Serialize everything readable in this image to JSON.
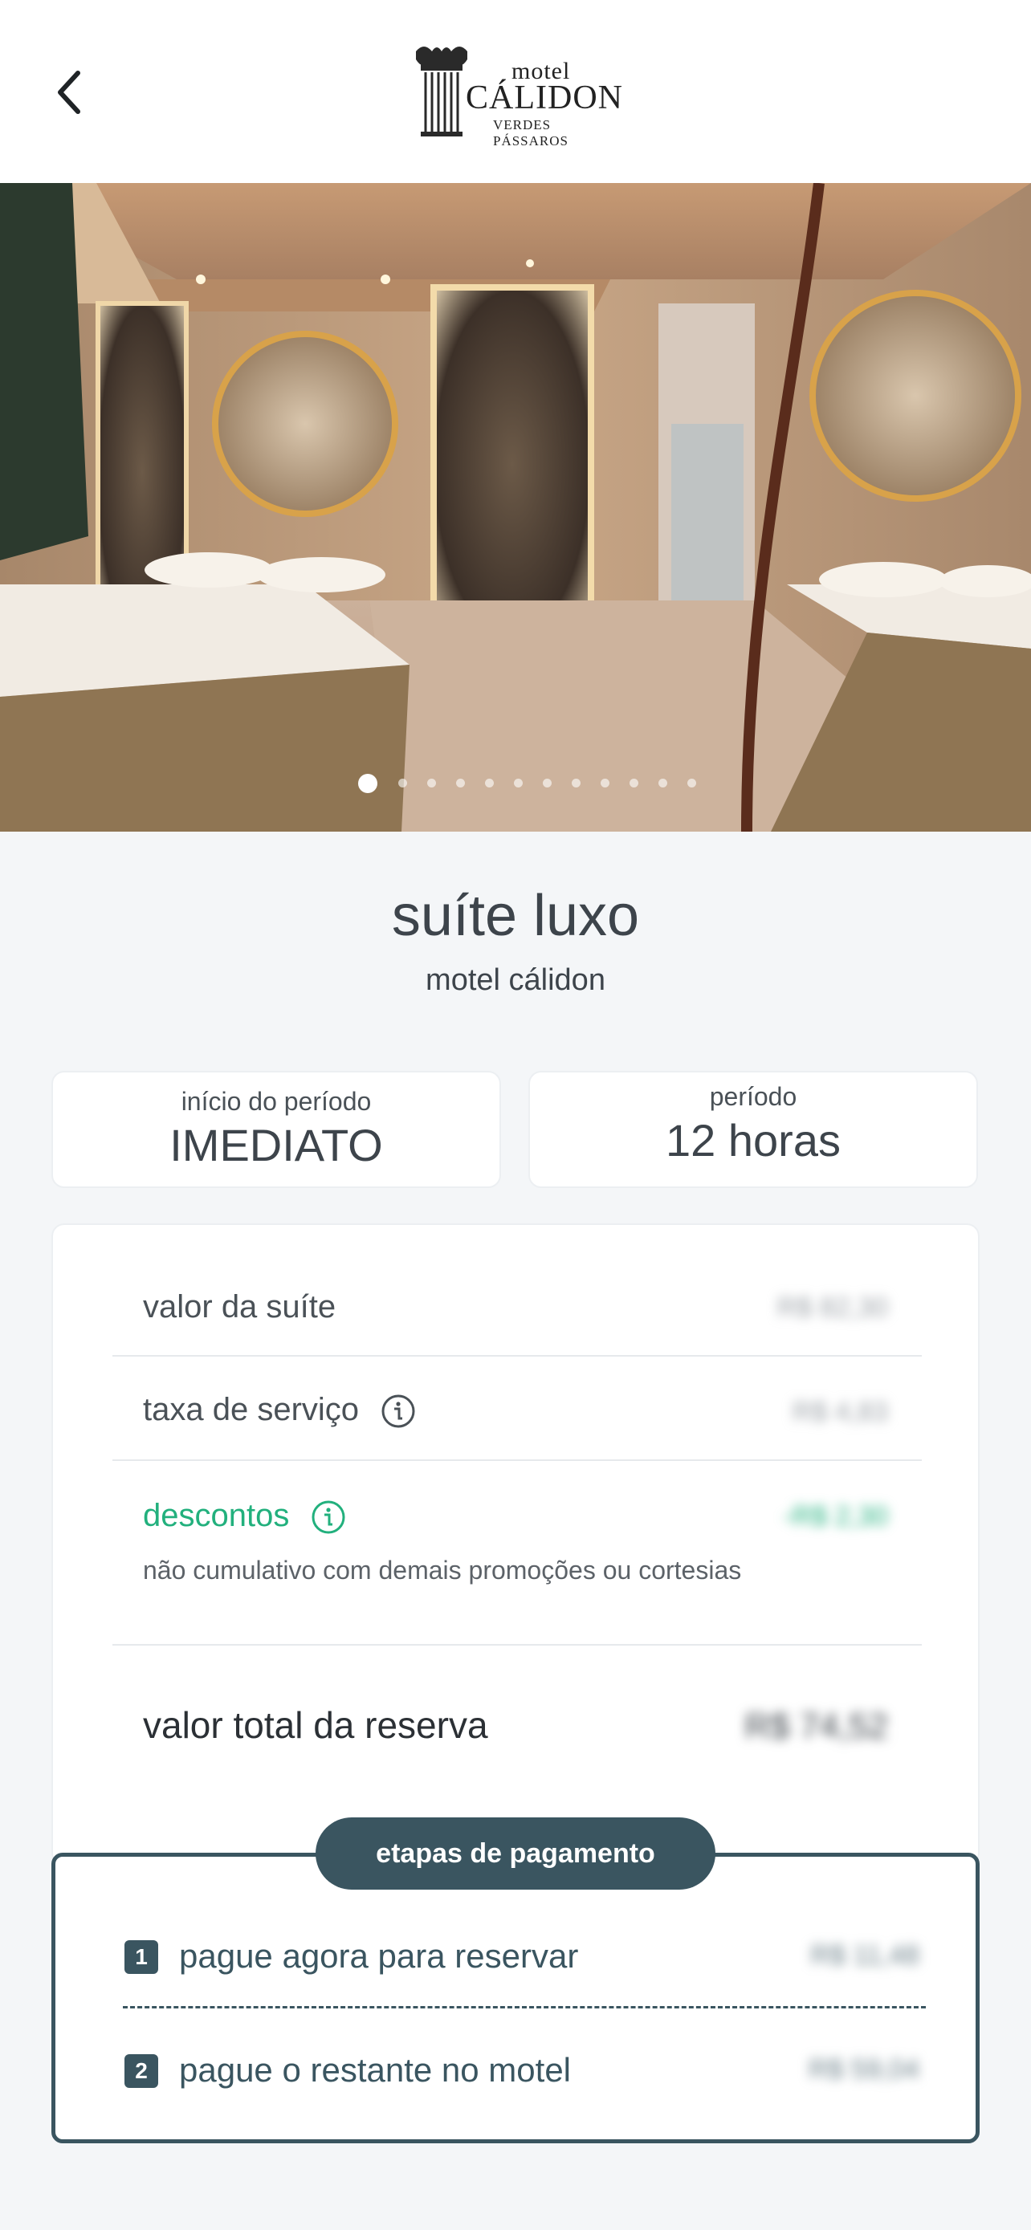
{
  "header": {
    "back_icon": "chevron-left-icon",
    "logo": {
      "line1": "motel",
      "line2": "CÁLIDON",
      "line3": "VERDES PÁSSAROS"
    }
  },
  "gallery": {
    "total_images": 12,
    "current_index": 1
  },
  "suite": {
    "name": "suíte luxo",
    "motel": "motel cálidon"
  },
  "period": {
    "start_label": "início do período",
    "start_value": "IMEDIATO",
    "duration_label": "período",
    "duration_value": "12 horas"
  },
  "summary": {
    "suite_value_label": "valor da suíte",
    "suite_value": "R$ 82,30",
    "service_fee_label": "taxa de serviço",
    "service_fee": "R$ 4,83",
    "discounts_label": "descontos",
    "discounts_value": "-R$ 2,30",
    "discounts_note": "não cumulativo com demais promoções ou cortesias",
    "total_label": "valor total da reserva",
    "total_value": "R$ 74,52"
  },
  "payment_steps": {
    "title": "etapas de pagamento",
    "steps": [
      {
        "num": "1",
        "label": "pague agora para reservar",
        "value": "R$ 11,48"
      },
      {
        "num": "2",
        "label": "pague o restante no motel",
        "value": "R$ 59,04"
      }
    ]
  },
  "colors": {
    "accent_dark": "#3a5560",
    "discount_green": "#22b07d",
    "background": "#f4f6f8"
  }
}
